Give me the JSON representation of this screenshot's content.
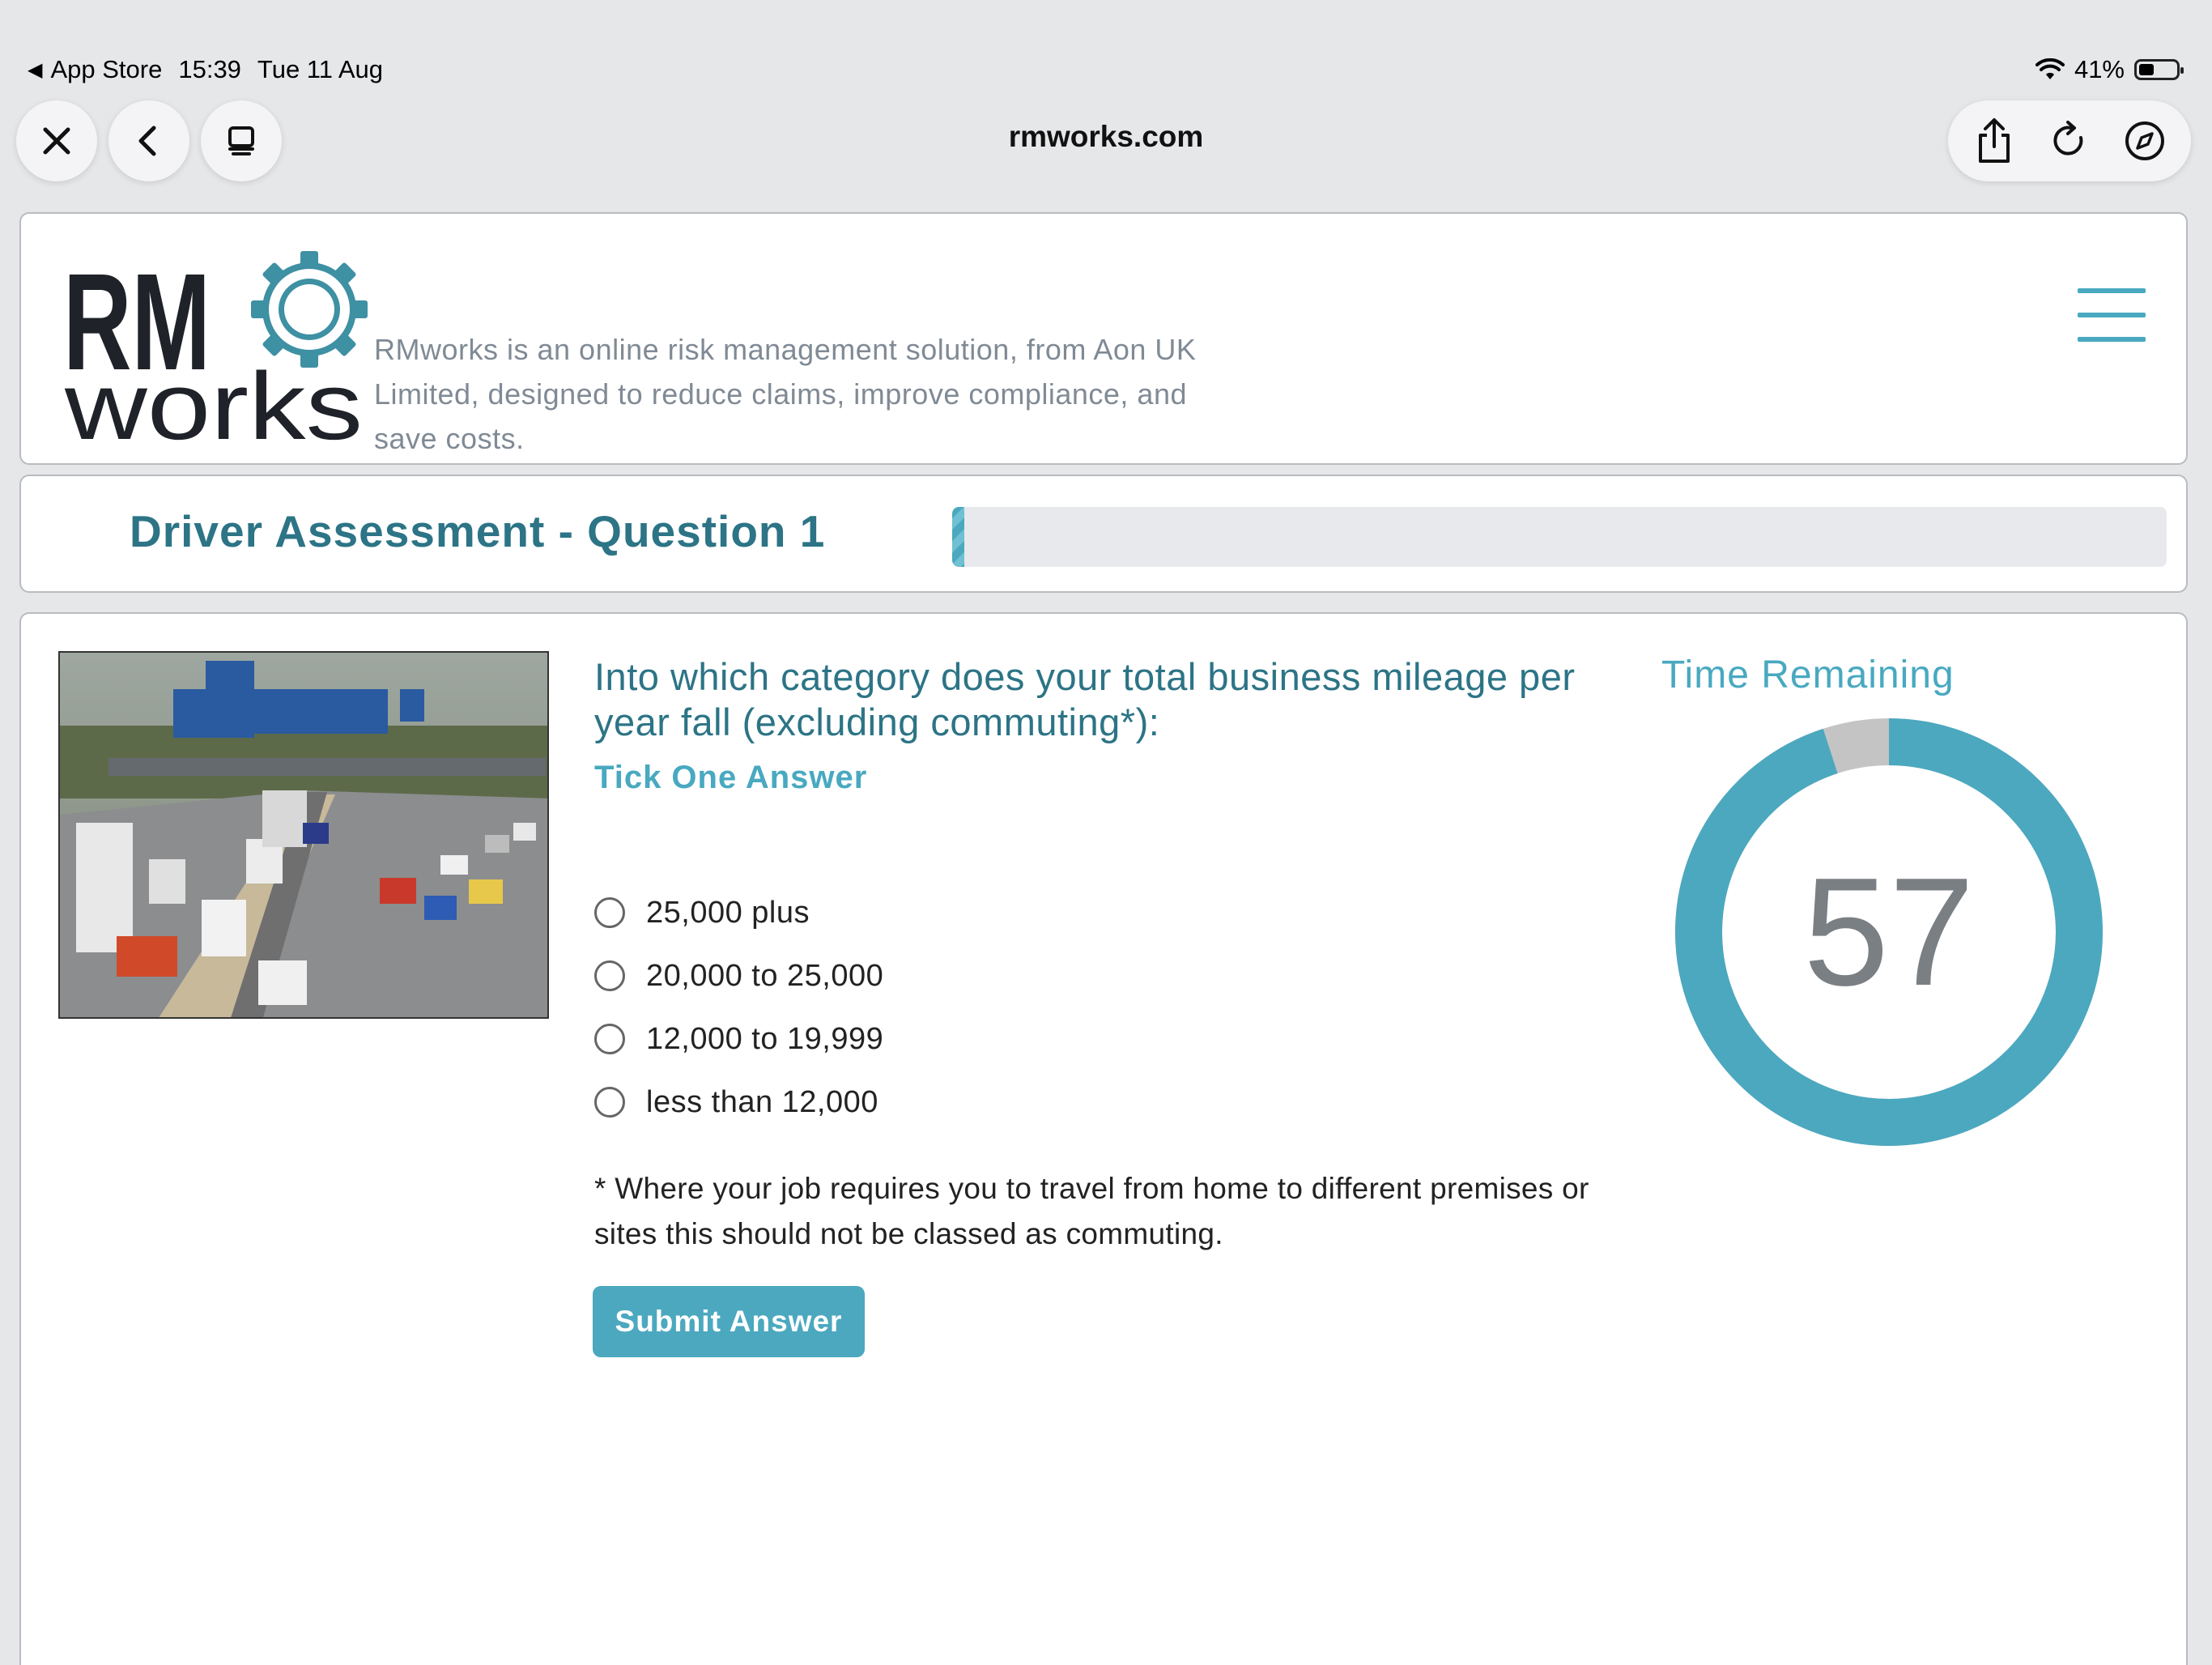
{
  "status_bar": {
    "back_app": "App Store",
    "time": "15:39",
    "date": "Tue 11 Aug",
    "battery": "41%",
    "battery_level": 0.41
  },
  "browser": {
    "url": "rmworks.com",
    "icons": [
      "close-icon",
      "back-icon",
      "tabs-icon",
      "share-icon",
      "reload-icon",
      "compass-icon"
    ]
  },
  "header": {
    "logo_line1": "RM",
    "logo_line2": "works",
    "tagline": "RMworks is an online risk management solution, from Aon UK Limited, designed to reduce claims, improve compliance, and save costs."
  },
  "assessment": {
    "title": "Driver Assessment - Question 1",
    "progress": 0.01
  },
  "question": {
    "text": "Into which category does your total business mileage per year fall (excluding commuting*):",
    "instruction": "Tick One Answer",
    "options": [
      "25,000 plus",
      "20,000 to 25,000",
      "12,000 to 19,999",
      "less than 12,000"
    ],
    "footnote": "* Where your job requires you to travel from home to different premises or sites this should not be classed as commuting.",
    "submit_label": "Submit Answer"
  },
  "timer": {
    "label": "Time Remaining",
    "value": "57",
    "total_seconds": 60,
    "remaining_seconds": 57
  },
  "colors": {
    "accent": "#4ba8bf",
    "title": "#2c7486",
    "timer_elapsed": "#c4c4c4",
    "timer_number": "#7a7f84"
  }
}
